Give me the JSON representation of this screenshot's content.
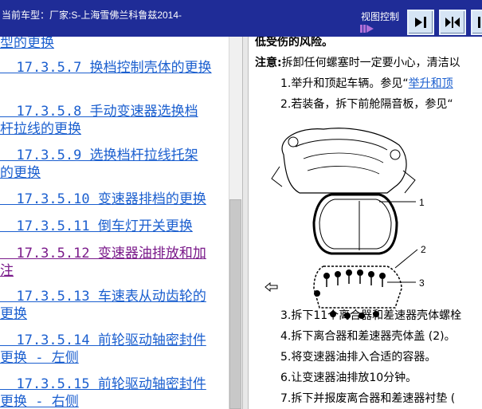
{
  "header": {
    "car_model": "当前车型：厂家:S-上海雪佛兰科鲁兹2014-",
    "view_control": "视图控制"
  },
  "nav": {
    "items": [
      {
        "text": "型的更换",
        "visited": false
      },
      {
        "text": "  17.3.5.7 换档控制壳体的更换",
        "visited": false
      },
      {
        "text": "  17.3.5.8 手动变速器选换档",
        "visited": false
      },
      {
        "text": "杆拉线的更换",
        "visited": false
      },
      {
        "text": "  17.3.5.9 选换档杆拉线托架",
        "visited": false
      },
      {
        "text": "的更换",
        "visited": false
      },
      {
        "text": "  17.3.5.10 变速器排档的更换",
        "visited": false
      },
      {
        "text": "  17.3.5.11 倒车灯开关更换",
        "visited": false
      },
      {
        "text": "  17.3.5.12 变速器油排放和加",
        "visited": true
      },
      {
        "text": "注",
        "visited": true
      },
      {
        "text": "  17.3.5.13 车速表从动齿轮的",
        "visited": false
      },
      {
        "text": "更换",
        "visited": false
      },
      {
        "text": "  17.3.5.14 前轮驱动轴密封件",
        "visited": false
      },
      {
        "text": "更换 - 左侧",
        "visited": false
      },
      {
        "text": "  17.3.5.15 前轮驱动轴密封件",
        "visited": false
      },
      {
        "text": "更换 - 右侧",
        "visited": false
      }
    ]
  },
  "content": {
    "risk_line": "低受伤的风险。",
    "note_label": "注意:",
    "note_text": "拆卸任何螺塞时一定要小心，清洁以",
    "step1_text": "1.举升和顶起车辆。参见“",
    "step1_link": "举升和顶",
    "step2_text": "2.若装备，拆下前舱隔音板，参见“",
    "callouts": [
      "1",
      "2",
      "3"
    ],
    "step3": "3.拆下11个离合器和差速器壳体螺栓",
    "step4": "4.拆下离合器和差速器壳体盖 (2)。",
    "step5": "5.将变速器油排入合适的容器。",
    "step6": "6.让变速器油排放10分钟。",
    "step7": "7.拆下并报废离合器和差速器衬垫 ("
  },
  "colors": {
    "header_bg": "#1f2c97",
    "link": "#1b5fcf",
    "visited_link": "#7a1a8a"
  }
}
